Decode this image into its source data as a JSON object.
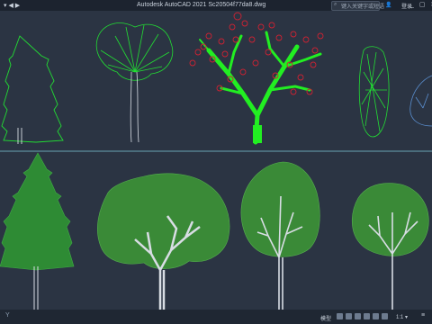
{
  "titlebar": {
    "left_icons": "▾ ◀ ▶",
    "title": "Autodesk AutoCAD 2021   Sc20504f77da8.dwg",
    "search_placeholder": "键入关键字或短语",
    "user_label": "登录",
    "window_controls": "_ ▢ ✕"
  },
  "statusbar": {
    "axis_label": "Y",
    "model_label": "模型",
    "scale_label": "1:1 ▾",
    "menu_icon": "≡"
  },
  "colors": {
    "background": "#2b3443",
    "outline_tree": "#22dd33",
    "pine_fill": "#2e8b34",
    "canopy_fill": "#3a8a37",
    "branch_green": "#22ee22",
    "leaf_red": "#cc2233",
    "trunk_white": "#d8dde4",
    "line_cyan": "#7ec8d8"
  }
}
